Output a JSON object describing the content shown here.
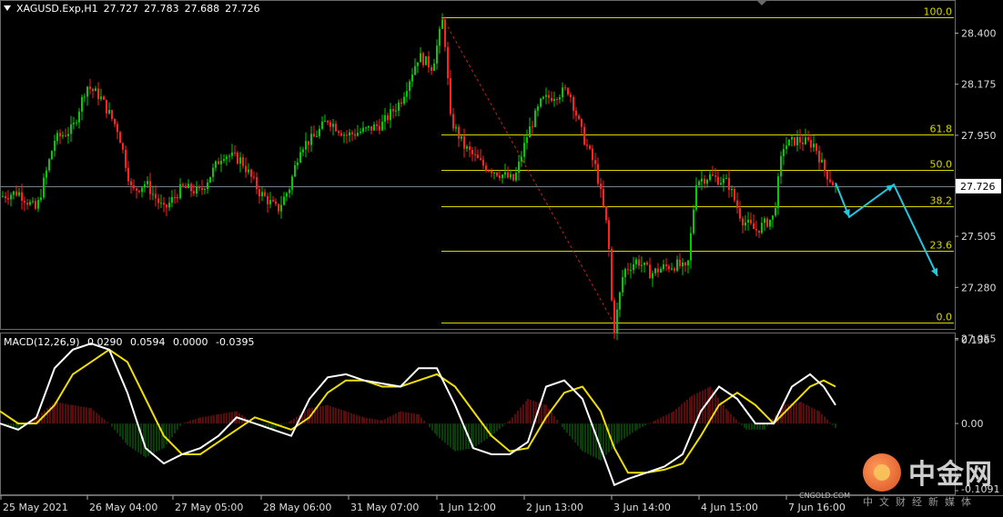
{
  "header": {
    "symbol": "XAGUSD.Exp,H1",
    "open": "27.727",
    "high": "27.783",
    "low": "27.688",
    "close": "27.726"
  },
  "price_axis": {
    "ticks": [
      "28.400",
      "28.175",
      "27.950",
      "27.725",
      "27.505",
      "27.280",
      "27.055"
    ],
    "current_price": "27.726"
  },
  "fibonacci": {
    "levels": [
      "100.0",
      "61.8",
      "50.0",
      "38.2",
      "23.6",
      "0.0"
    ]
  },
  "macd": {
    "label": "MACD(12,26,9)",
    "values": [
      "0.0290",
      "0.0594",
      "0.0000",
      "-0.0395"
    ],
    "axis_ticks": [
      "0.136",
      "0.00",
      "-0.1091"
    ]
  },
  "time_axis": {
    "labels": [
      "25 May 2021",
      "26 May 04:00",
      "27 May 05:00",
      "28 May 06:00",
      "31 May 07:00",
      "1 Jun 12:00",
      "2 Jun 13:00",
      "3 Jun 14:00",
      "4 Jun 15:00",
      "7 Jun 16:00"
    ]
  },
  "watermark": {
    "name": "中金网",
    "url": "CNGOLD.COM",
    "subtitle": "中文财经新媒体"
  },
  "colors": {
    "bull": "#00cc00",
    "bear": "#ff2020",
    "fib": "#d8d800",
    "macd_line": "#ffffff",
    "signal_line": "#f0e000",
    "projection": "#22c8e0"
  },
  "chart_data": {
    "type": "candlestick",
    "symbol": "XAGUSD.Exp",
    "timeframe": "H1",
    "y_range": [
      27.0,
      28.52
    ],
    "close_path": [
      [
        0,
        27.68
      ],
      [
        20,
        27.7
      ],
      [
        40,
        27.62
      ],
      [
        60,
        27.93
      ],
      [
        80,
        27.98
      ],
      [
        95,
        28.17
      ],
      [
        110,
        28.12
      ],
      [
        130,
        27.97
      ],
      [
        145,
        27.7
      ],
      [
        160,
        27.74
      ],
      [
        180,
        27.62
      ],
      [
        200,
        27.72
      ],
      [
        220,
        27.7
      ],
      [
        245,
        27.87
      ],
      [
        265,
        27.84
      ],
      [
        285,
        27.7
      ],
      [
        305,
        27.62
      ],
      [
        318,
        27.72
      ],
      [
        330,
        27.9
      ],
      [
        345,
        27.94
      ],
      [
        360,
        28.02
      ],
      [
        380,
        27.95
      ],
      [
        400,
        27.97
      ],
      [
        420,
        28.0
      ],
      [
        440,
        28.1
      ],
      [
        460,
        28.3
      ],
      [
        475,
        28.25
      ],
      [
        487,
        28.47
      ],
      [
        495,
        28.02
      ],
      [
        510,
        27.9
      ],
      [
        530,
        27.82
      ],
      [
        550,
        27.78
      ],
      [
        565,
        27.75
      ],
      [
        580,
        27.96
      ],
      [
        595,
        28.1
      ],
      [
        610,
        28.13
      ],
      [
        625,
        28.15
      ],
      [
        640,
        27.95
      ],
      [
        655,
        27.8
      ],
      [
        668,
        27.52
      ],
      [
        674,
        27.07
      ],
      [
        685,
        27.35
      ],
      [
        700,
        27.4
      ],
      [
        715,
        27.34
      ],
      [
        730,
        27.37
      ],
      [
        745,
        27.38
      ],
      [
        755,
        27.35
      ],
      [
        765,
        27.75
      ],
      [
        780,
        27.77
      ],
      [
        800,
        27.74
      ],
      [
        815,
        27.58
      ],
      [
        830,
        27.53
      ],
      [
        850,
        27.59
      ],
      [
        860,
        27.9
      ],
      [
        875,
        27.93
      ],
      [
        895,
        27.91
      ],
      [
        905,
        27.8
      ],
      [
        918,
        27.72
      ]
    ],
    "fib_levels": [
      {
        "label": "100.0",
        "price": 28.47
      },
      {
        "label": "61.8",
        "price": 27.955
      },
      {
        "label": "50.0",
        "price": 27.797
      },
      {
        "label": "38.2",
        "price": 27.638
      },
      {
        "label": "23.6",
        "price": 27.442
      },
      {
        "label": "0.0",
        "price": 27.125
      }
    ],
    "projection": [
      [
        918,
        27.74
      ],
      [
        933,
        27.59
      ],
      [
        982,
        27.733
      ],
      [
        1030,
        27.33
      ]
    ],
    "current_price": 27.726,
    "macd_range": [
      -0.1091,
      0.136
    ],
    "macd_series": [
      [
        0,
        0.0
      ],
      [
        20,
        -0.01
      ],
      [
        40,
        0.01
      ],
      [
        60,
        0.09
      ],
      [
        80,
        0.12
      ],
      [
        100,
        0.13
      ],
      [
        120,
        0.12
      ],
      [
        140,
        0.05
      ],
      [
        160,
        -0.04
      ],
      [
        180,
        -0.065
      ],
      [
        200,
        -0.05
      ],
      [
        220,
        -0.04
      ],
      [
        240,
        -0.02
      ],
      [
        260,
        0.01
      ],
      [
        280,
        0.0
      ],
      [
        300,
        -0.01
      ],
      [
        320,
        -0.02
      ],
      [
        340,
        0.04
      ],
      [
        360,
        0.075
      ],
      [
        380,
        0.08
      ],
      [
        400,
        0.07
      ],
      [
        420,
        0.065
      ],
      [
        440,
        0.06
      ],
      [
        460,
        0.09
      ],
      [
        480,
        0.09
      ],
      [
        500,
        0.03
      ],
      [
        520,
        -0.04
      ],
      [
        540,
        -0.05
      ],
      [
        560,
        -0.05
      ],
      [
        580,
        -0.03
      ],
      [
        600,
        0.06
      ],
      [
        620,
        0.07
      ],
      [
        640,
        0.04
      ],
      [
        660,
        -0.04
      ],
      [
        675,
        -0.1
      ],
      [
        690,
        -0.09
      ],
      [
        710,
        -0.08
      ],
      [
        730,
        -0.07
      ],
      [
        750,
        -0.05
      ],
      [
        770,
        0.02
      ],
      [
        790,
        0.06
      ],
      [
        810,
        0.04
      ],
      [
        830,
        0.0
      ],
      [
        850,
        0.0
      ],
      [
        870,
        0.06
      ],
      [
        890,
        0.08
      ],
      [
        905,
        0.06
      ],
      [
        918,
        0.03
      ]
    ],
    "signal_series": [
      [
        0,
        0.02
      ],
      [
        20,
        0.0
      ],
      [
        40,
        0.0
      ],
      [
        60,
        0.03
      ],
      [
        80,
        0.08
      ],
      [
        100,
        0.1
      ],
      [
        120,
        0.12
      ],
      [
        140,
        0.1
      ],
      [
        160,
        0.04
      ],
      [
        180,
        -0.02
      ],
      [
        200,
        -0.05
      ],
      [
        220,
        -0.05
      ],
      [
        240,
        -0.03
      ],
      [
        260,
        -0.01
      ],
      [
        280,
        0.01
      ],
      [
        300,
        0.0
      ],
      [
        320,
        -0.01
      ],
      [
        340,
        0.01
      ],
      [
        360,
        0.05
      ],
      [
        380,
        0.07
      ],
      [
        400,
        0.07
      ],
      [
        420,
        0.06
      ],
      [
        440,
        0.06
      ],
      [
        460,
        0.07
      ],
      [
        480,
        0.08
      ],
      [
        500,
        0.06
      ],
      [
        520,
        0.02
      ],
      [
        540,
        -0.02
      ],
      [
        560,
        -0.045
      ],
      [
        580,
        -0.04
      ],
      [
        600,
        0.01
      ],
      [
        620,
        0.05
      ],
      [
        640,
        0.06
      ],
      [
        660,
        0.02
      ],
      [
        675,
        -0.04
      ],
      [
        690,
        -0.08
      ],
      [
        710,
        -0.08
      ],
      [
        730,
        -0.075
      ],
      [
        750,
        -0.065
      ],
      [
        770,
        -0.02
      ],
      [
        790,
        0.03
      ],
      [
        810,
        0.05
      ],
      [
        830,
        0.03
      ],
      [
        850,
        0.0
      ],
      [
        870,
        0.03
      ],
      [
        890,
        0.06
      ],
      [
        905,
        0.07
      ],
      [
        918,
        0.06
      ]
    ],
    "histogram_values": [
      0.0,
      -0.01,
      0.01,
      0.035,
      0.03,
      0.025,
      0.0,
      -0.035,
      -0.055,
      -0.04,
      0.0,
      0.01,
      0.015,
      0.02,
      0.0,
      -0.01,
      0.005,
      0.025,
      0.03,
      0.02,
      0.01,
      0.005,
      0.02,
      0.015,
      -0.02,
      -0.045,
      -0.04,
      -0.02,
      0.005,
      0.04,
      0.03,
      -0.01,
      -0.045,
      -0.06,
      -0.03,
      -0.01,
      0.005,
      0.02,
      0.045,
      0.06,
      0.02,
      -0.01,
      -0.01,
      0.03,
      0.035,
      0.02,
      -0.01
    ]
  }
}
